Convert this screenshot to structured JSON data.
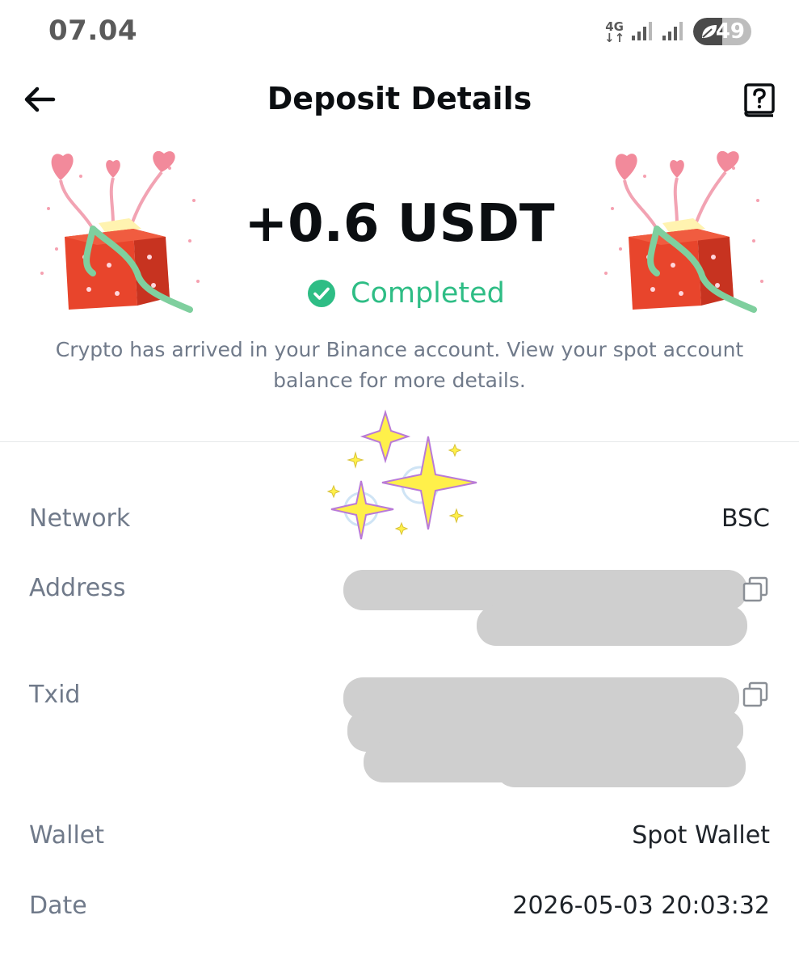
{
  "status_bar": {
    "time": "07.04",
    "network": "4G",
    "battery": "49",
    "icons": [
      "network-4g-icon",
      "signal-icon",
      "signal-icon",
      "battery-saver-icon"
    ]
  },
  "header": {
    "title": "Deposit Details",
    "back_icon": "arrow-left-icon",
    "help_icon": "help-book-icon"
  },
  "deposit": {
    "amount": "+0.6 USDT",
    "status": "Completed",
    "status_icon": "check-circle-icon",
    "note": "Crypto has arrived in your Binance account. View your spot account balance for more details."
  },
  "details": {
    "network": {
      "label": "Network",
      "value": "BSC"
    },
    "address": {
      "label": "Address",
      "copy_icon": "copy-icon"
    },
    "txid": {
      "label": "Txid",
      "copy_icon": "copy-icon"
    },
    "wallet": {
      "label": "Wallet",
      "value": "Spot Wallet"
    },
    "date": {
      "label": "Date",
      "value": "2026-05-03 20:03:32"
    }
  },
  "colors": {
    "success": "#2ebd85",
    "title": "#0b0e11",
    "muted": "#707a8a",
    "gift_red": "#e8452c",
    "ribbon": "#7fcf9e",
    "heart": "#f28a9b",
    "sparkle": "#fff04a"
  }
}
